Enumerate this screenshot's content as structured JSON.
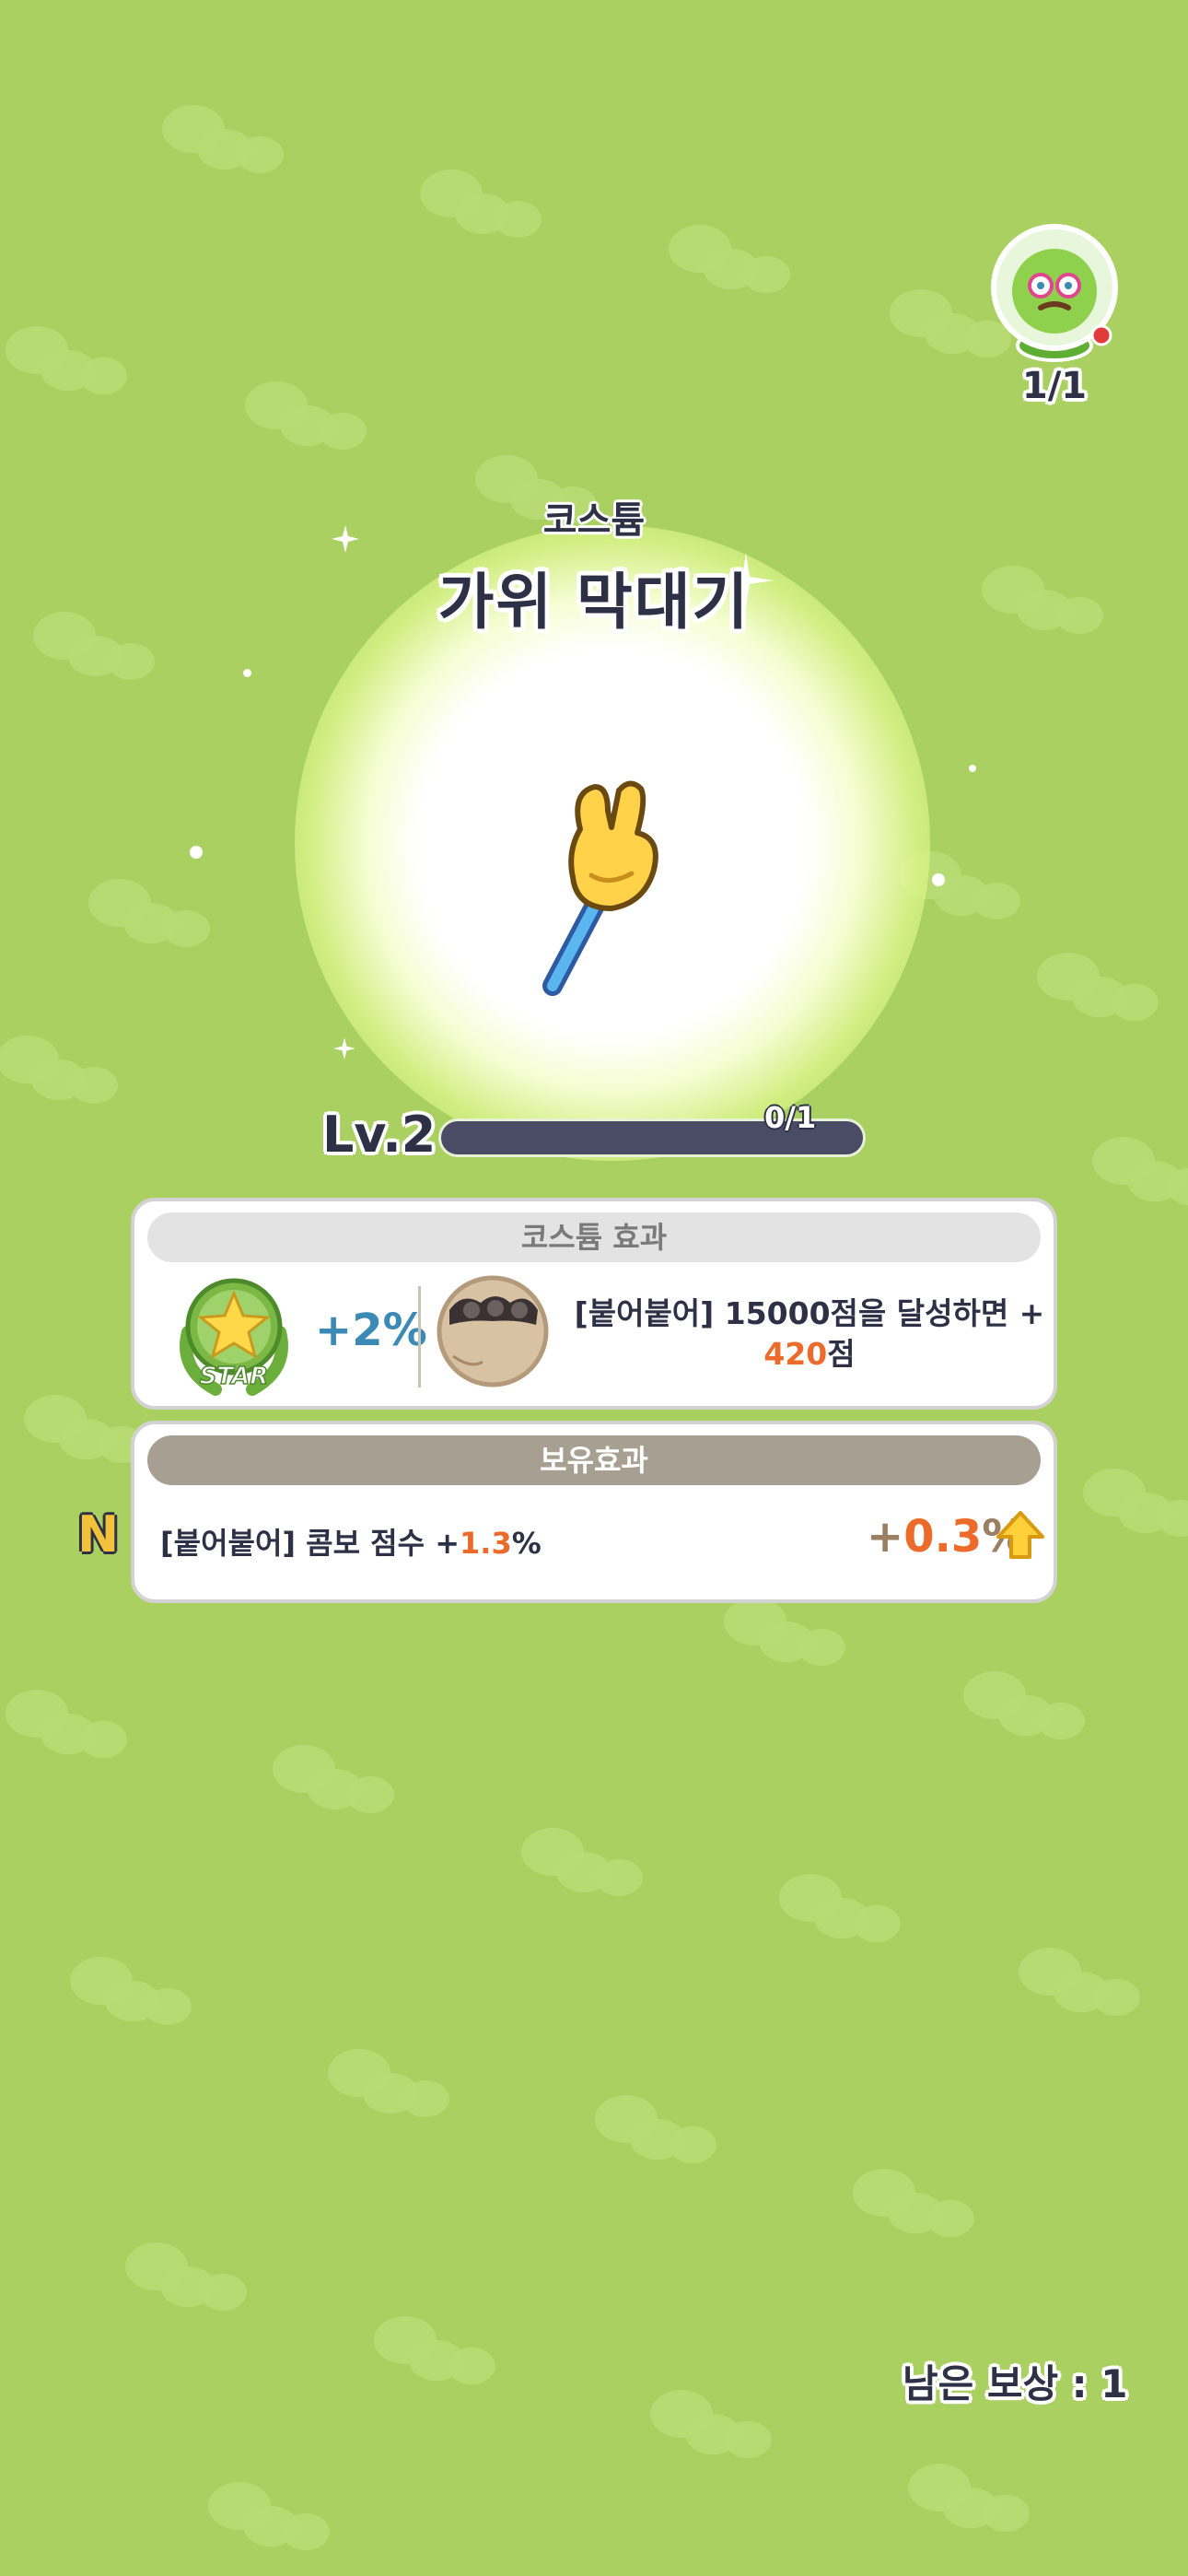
{
  "collection": {
    "counter": "1/1"
  },
  "item": {
    "category": "코스튬",
    "name": "가위 막대기"
  },
  "level": {
    "label": "Lv.2",
    "progress_text": "0/1",
    "progress_fraction": 0
  },
  "costume_effect": {
    "header": "코스튬 효과",
    "badge_text": "STAR",
    "bonus": "+2%",
    "desc_line1": "[붙어붙어] 15000점을 달성하면 +",
    "desc_value": "420",
    "desc_suffix": "점"
  },
  "holding_effect": {
    "header": "보유효과",
    "grade": "N",
    "desc_prefix": "[붙어붙어] 콤보 점수 +",
    "desc_value": "1.3",
    "desc_suffix": "%",
    "bonus_plus": "+",
    "bonus_value": "0.3",
    "bonus_suffix": "%"
  },
  "footer": {
    "remaining_reward": "남은 보상 : 1"
  },
  "colors": {
    "background": "#a9d060",
    "text_dark": "#2e3146",
    "accent_orange": "#ec6a2a",
    "accent_blue": "#3a8ab5",
    "grade_gold": "#f2c23a"
  },
  "icons": [
    "gacha-capsule-icon",
    "scissors-stick-icon",
    "star-badge-icon",
    "cookie-avatar-icon",
    "upgrade-arrow-icon",
    "sparkle-icon"
  ]
}
